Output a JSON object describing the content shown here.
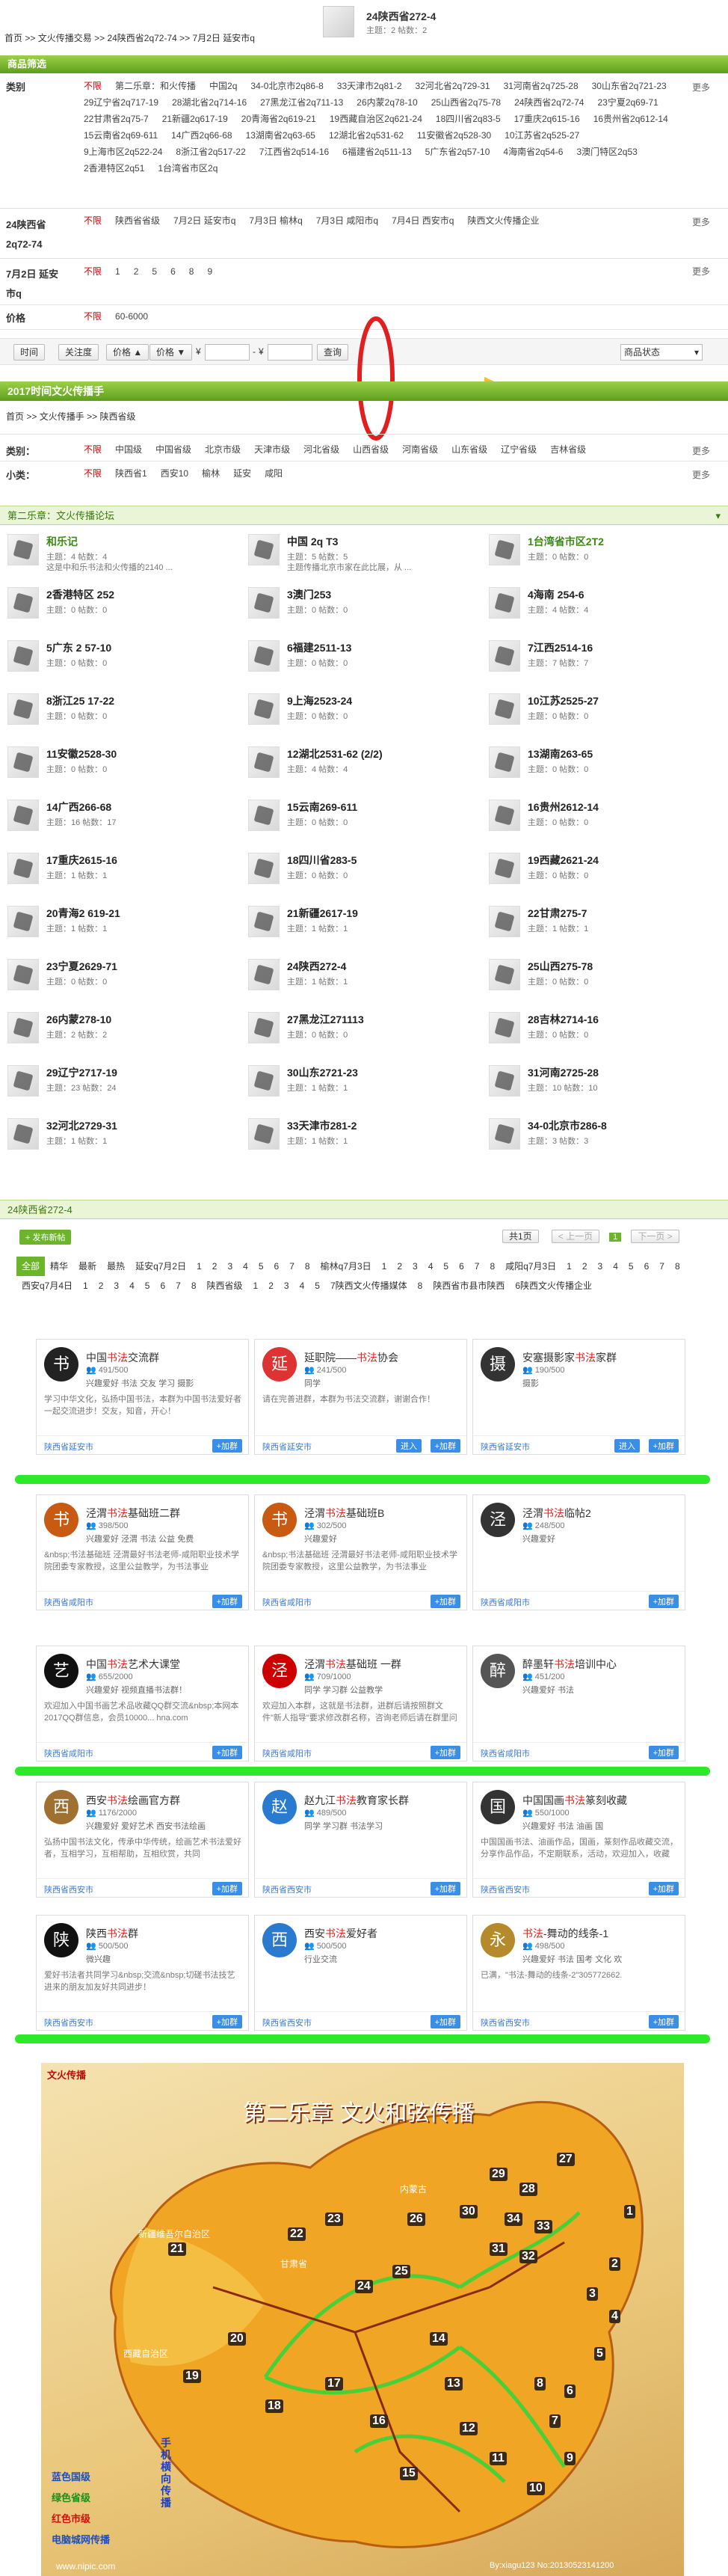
{
  "breadcrumb": {
    "items": [
      "首页",
      ">>",
      "文火传播交易",
      ">>",
      "24陕西省2q72-74",
      ">>",
      "7月2日 延安市q"
    ]
  },
  "forum_header": {
    "title": "24陕西省272-4",
    "stats": "主题：2 帖数：2"
  },
  "filter": {
    "section_title": "商品筛选",
    "rows": [
      {
        "label": "类别",
        "options": [
          "不限",
          "第二乐章：和火传播",
          "中国2q",
          "34-0北京市2q86-8",
          "33天津市2q81-2",
          "32河北省2q729-31",
          "31河南省2q725-28",
          "30山东省2q721-23",
          "29辽宁省2q717-19",
          "28湖北省2q714-16",
          "27黑龙江省2q711-13",
          "26内蒙2q78-10",
          "25山西省2q75-78",
          "24陕西省2q72-74",
          "23宁夏2q69-71",
          "22甘肃省2q75-7",
          "21新疆2q617-19",
          "20青海省2q619-21",
          "19西藏自治区2q621-24",
          "18四川省2q83-5",
          "17重庆2q615-16",
          "16贵州省2q612-14",
          "15云南省2q69-611",
          "14广西2q66-68",
          "13湖南省2q63-65",
          "12湖北省2q531-62",
          "11安徽省2q528-30",
          "10江苏省2q525-27",
          "9上海市区2q522-24",
          "8浙江省2q517-22",
          "7江西省2q514-16",
          "6福建省2q511-13",
          "5广东省2q57-10",
          "4海南省2q54-6",
          "3澳门特区2q53",
          "2香港特区2q51",
          "1台湾省市区2q"
        ],
        "more": "更多"
      },
      {
        "label": "24陕西省2q72-74",
        "options": [
          "不限",
          "陕西省省级",
          "7月2日 延安市q",
          "7月3日 榆林q",
          "7月3日 咸阳市q",
          "7月4日 西安市q",
          "陕西文火传播企业"
        ],
        "more": "更多"
      },
      {
        "label": "7月2日 延安市q",
        "options": [
          "不限",
          "1",
          "2",
          "5",
          "6",
          "8",
          "9"
        ],
        "more": "更多"
      },
      {
        "label": "价格",
        "options": [
          "不限",
          "60-6000"
        ],
        "more": ""
      }
    ]
  },
  "toolbar": {
    "time": "时间",
    "follow": "关注度",
    "price_asc": "价格 ▲",
    "price_desc": "价格 ▼",
    "currency": "¥",
    "dash": "-",
    "query": "查询",
    "status": "商品状态"
  },
  "cat_section": {
    "title": "2017时间文火传播手",
    "crumb": [
      "首页",
      ">>",
      "文火传播手",
      ">>",
      "陕西省级"
    ]
  },
  "cat_filter": {
    "rows": [
      {
        "label": "类别：",
        "options": [
          "不限",
          "中国级",
          "中国省级",
          "北京市级",
          "天津市级",
          "河北省级",
          "山西省级",
          "河南省级",
          "山东省级",
          "辽宁省级",
          "吉林省级"
        ],
        "more": "更多"
      },
      {
        "label": "小类：",
        "options": [
          "不限",
          "陕西省1",
          "西安10",
          "榆林",
          "延安",
          "咸阳"
        ],
        "more": "更多"
      }
    ]
  },
  "forum_section": {
    "title": "第二乐章：文火传播论坛"
  },
  "forums": [
    {
      "name": "和乐记",
      "stat": "主题：4 帖数：4",
      "desc": "这是中和乐书法和火传播的2140 ..."
    },
    {
      "name": "中国 2q T3",
      "stat": "主题：5 帖数：5",
      "desc": "主题传播北京市家在此比展，从 ..."
    },
    {
      "name": "1台湾省市区2T2",
      "stat": "主题：0 帖数：0",
      "desc": ""
    },
    {
      "name": "2香港特区 252",
      "stat": "主题：0 帖数：0",
      "desc": ""
    },
    {
      "name": "3澳门253",
      "stat": "主题：0 帖数：0",
      "desc": ""
    },
    {
      "name": "4海南 254-6",
      "stat": "主题：4 帖数：4",
      "desc": ""
    },
    {
      "name": "5广东 2 57-10",
      "stat": "主题：0 帖数：0",
      "desc": ""
    },
    {
      "name": "6福建2511-13",
      "stat": "主题：0 帖数：0",
      "desc": ""
    },
    {
      "name": "7江西2514-16",
      "stat": "主题：7 帖数：7",
      "desc": ""
    },
    {
      "name": "8浙江25 17-22",
      "stat": "主题：0 帖数：0",
      "desc": ""
    },
    {
      "name": "9上海2523-24",
      "stat": "主题：0 帖数：0",
      "desc": ""
    },
    {
      "name": "10江苏2525-27",
      "stat": "主题：0 帖数：0",
      "desc": ""
    },
    {
      "name": "11安徽2528-30",
      "stat": "主题：0 帖数：0",
      "desc": ""
    },
    {
      "name": "12湖北2531-62 (2/2)",
      "stat": "主题：4 帖数：4",
      "desc": ""
    },
    {
      "name": "13湖南263-65",
      "stat": "主题：0 帖数：0",
      "desc": ""
    },
    {
      "name": "14广西266-68",
      "stat": "主题：16 帖数：17",
      "desc": ""
    },
    {
      "name": "15云南269-611",
      "stat": "主题：0 帖数：0",
      "desc": ""
    },
    {
      "name": "16贵州2612-14",
      "stat": "主题：0 帖数：0",
      "desc": ""
    },
    {
      "name": "17重庆2615-16",
      "stat": "主题：1 帖数：1",
      "desc": ""
    },
    {
      "name": "18四川省283-5",
      "stat": "主题：0 帖数：0",
      "desc": ""
    },
    {
      "name": "19西藏2621-24",
      "stat": "主题：0 帖数：0",
      "desc": ""
    },
    {
      "name": "20青海2 619-21",
      "stat": "主题：1 帖数：1",
      "desc": ""
    },
    {
      "name": "21新疆2617-19",
      "stat": "主题：1 帖数：1",
      "desc": ""
    },
    {
      "name": "22甘肃275-7",
      "stat": "主题：1 帖数：1",
      "desc": ""
    },
    {
      "name": "23宁夏2629-71",
      "stat": "主题：0 帖数：0",
      "desc": ""
    },
    {
      "name": "24陕西272-4",
      "stat": "主题：1 帖数：1",
      "desc": ""
    },
    {
      "name": "25山西275-78",
      "stat": "主题：0 帖数：0",
      "desc": ""
    },
    {
      "name": "26内蒙278-10",
      "stat": "主题：2 帖数：2",
      "desc": ""
    },
    {
      "name": "27黑龙江271113",
      "stat": "主题：0 帖数：0",
      "desc": ""
    },
    {
      "name": "28吉林2714-16",
      "stat": "主题：0 帖数：0",
      "desc": ""
    },
    {
      "name": "29辽宁2717-19",
      "stat": "主题：23 帖数：24",
      "desc": ""
    },
    {
      "name": "30山东2721-23",
      "stat": "主题：1 帖数：1",
      "desc": ""
    },
    {
      "name": "31河南2725-28",
      "stat": "主题：10 帖数：10",
      "desc": ""
    },
    {
      "name": "32河北2729-31",
      "stat": "主题：1 帖数：1",
      "desc": ""
    },
    {
      "name": "33天津市281-2",
      "stat": "主题：1 帖数：1",
      "desc": ""
    },
    {
      "name": "34-0北京市286-8",
      "stat": "主题：3 帖数：3",
      "desc": ""
    }
  ],
  "thread_section": {
    "title": "24陕西省272-4",
    "new_post": "+ 发布新帖",
    "pager_total": "共1页",
    "pager_prev": "< 上一页",
    "pager_current": "1",
    "pager_next": "下一页 >",
    "tabs": [
      "全部",
      "精华",
      "最新",
      "最热",
      "延安q7月2日",
      "1",
      "2",
      "3",
      "4",
      "5",
      "6",
      "7",
      "8",
      "榆林q7月3日",
      "1",
      "2",
      "3",
      "4",
      "5",
      "6",
      "7",
      "8",
      "咸阳q7月3日",
      "1",
      "2",
      "3",
      "4",
      "5",
      "6",
      "7",
      "8",
      "西安q7月4日",
      "1",
      "2",
      "3",
      "4",
      "5",
      "6",
      "7",
      "8",
      "陕西省级",
      "1",
      "2",
      "3",
      "4",
      "5",
      "7陕西文火传播媒体",
      "8",
      "陕西省市县市陕西",
      "6陕西文火传播企业"
    ]
  },
  "groups": [
    {
      "avatar": "书",
      "pre": "中国",
      "hl": "书法",
      "post": "交流群",
      "count": "👥 491/500",
      "tags": "兴趣爱好  书法  交友  学习  摄影",
      "desc": "学习中华文化，弘扬中国书法，本群为中国书法爱好者一起交流进步！交友，知音，开心！",
      "loc": "陕西省延安市",
      "enter": "",
      "join": "+加群"
    },
    {
      "avatar": "延",
      "pre": "延职院——",
      "hl": "书法",
      "post": "协会",
      "count": "👥 241/500",
      "tags": "同学",
      "desc": "请在完善进群，本群为书法交流群，谢谢合作！",
      "loc": "陕西省延安市",
      "enter": "进入",
      "join": "+加群"
    },
    {
      "avatar": "摄",
      "pre": "安塞摄影家",
      "hl": "书法",
      "post": "家群",
      "count": "👥 190/500",
      "tags": "摄影",
      "desc": "",
      "loc": "陕西省延安市",
      "enter": "进入",
      "join": "+加群"
    },
    {
      "avatar": "书",
      "pre": "泾渭",
      "hl": "书法",
      "post": "基础班二群",
      "count": "👥 398/500",
      "tags": "兴趣爱好  泾渭  书法  公益  免费",
      "desc": "&nbsp;书法基础班 泾渭最好书法老师-咸阳职业技术学院团委专家教授，这里公益教学，为书法事业",
      "loc": "陕西省咸阳市",
      "enter": "",
      "join": "+加群"
    },
    {
      "avatar": "书",
      "pre": "泾渭",
      "hl": "书法",
      "post": "基础班B",
      "count": "👥 302/500",
      "tags": "兴趣爱好",
      "desc": "&nbsp;书法基础班 泾渭最好书法老师-咸阳职业技术学院团委专家教授，这里公益教学，为书法事业",
      "loc": "陕西省咸阳市",
      "enter": "",
      "join": "+加群"
    },
    {
      "avatar": "泾",
      "pre": "泾渭",
      "hl": "书法",
      "post": "临帖2",
      "count": "👥 248/500",
      "tags": "兴趣爱好",
      "desc": "",
      "loc": "陕西省咸阳市",
      "enter": "",
      "join": "+加群"
    },
    {
      "avatar": "艺",
      "pre": "中国",
      "hl": "书法",
      "post": "艺术大课堂",
      "count": "👥 655/2000",
      "tags": "兴趣爱好  视频直播书法群！",
      "desc": "欢迎加入中国书画艺术品收藏QQ群交流&nbsp;本网本2017QQ群信息，会员10000... hna.com",
      "loc": "陕西省咸阳市",
      "enter": "",
      "join": "+加群"
    },
    {
      "avatar": "泾",
      "pre": "泾渭",
      "hl": "书法",
      "post": "基础班 一群",
      "count": "👥 709/1000",
      "tags": "同学  学习群  公益教学",
      "desc": "欢迎加入本群，这就是书法群，进群后请按照群文件\"新人指导\"要求修改群名称，咨询老师后请在群里问",
      "loc": "陕西省咸阳市",
      "enter": "",
      "join": "+加群"
    },
    {
      "avatar": "醉",
      "pre": "醉墨轩",
      "hl": "书法",
      "post": "培训中心",
      "count": "👥 451/200",
      "tags": "兴趣爱好  书法",
      "desc": "",
      "loc": "陕西省咸阳市",
      "enter": "",
      "join": "+加群"
    },
    {
      "avatar": "西",
      "pre": "西安",
      "hl": "书法",
      "post": "绘画官方群",
      "count": "👥 1176/2000",
      "tags": "兴趣爱好  爱好艺术  西安书法绘画",
      "desc": "弘扬中国书法文化，传承中华传统，绘画艺术书法爱好者，互相学习，互相帮助，互相欣赏，共同",
      "loc": "陕西省西安市",
      "enter": "",
      "join": "+加群"
    },
    {
      "avatar": "赵",
      "pre": "赵九江",
      "hl": "书法",
      "post": "教育家长群",
      "count": "👥 489/500",
      "tags": "同学  学习群  书法学习",
      "desc": "",
      "loc": "陕西省西安市",
      "enter": "",
      "join": "+加群"
    },
    {
      "avatar": "国",
      "pre": "中国国画",
      "hl": "书法",
      "post": "篆刻收藏",
      "count": "👥 550/1000",
      "tags": "兴趣爱好  书法  油画  国",
      "desc": "中国国画书法、油画作品，国画，篆刻作品收藏交流，分享作品作品，不定期联系，活动，欢迎加入，收藏",
      "loc": "陕西省西安市",
      "enter": "",
      "join": "+加群"
    },
    {
      "avatar": "陕",
      "pre": "陕西",
      "hl": "书法",
      "post": "群",
      "count": "👥 500/500",
      "tags": "微兴趣",
      "desc": "爱好书法者共同学习&nbsp;交流&nbsp;切磋书法技艺进来的朋友加友好共同进步！",
      "loc": "陕西省西安市",
      "enter": "",
      "join": "+加群"
    },
    {
      "avatar": "西",
      "pre": "西安",
      "hl": "书法",
      "post": "爱好者",
      "count": "👥 500/500",
      "tags": "行业交流",
      "desc": "",
      "loc": "陕西省西安市",
      "enter": "",
      "join": "+加群"
    },
    {
      "avatar": "永",
      "pre": "",
      "hl": "书法",
      "post": "-舞动的线条-1",
      "count": "👥 498/500",
      "tags": "兴趣爱好  书法  国考  文化  欢",
      "desc": "已满，\"书法-舞动的线条-2\"305772662.",
      "loc": "陕西省西安市",
      "enter": "",
      "join": "+加群"
    }
  ],
  "map": {
    "title": "第二乐章   文火和弦传播",
    "logo": "文火传播",
    "legend": [
      "蓝色国级",
      "绿色省级",
      "红色市级",
      "电脑城网传播"
    ],
    "side_text": "手机横向传播",
    "watermark_left": "www.nipic.com",
    "watermark_right": "By:xiagu123 No:20130523141200",
    "labels": [
      "1",
      "2",
      "3",
      "4",
      "5",
      "6",
      "7",
      "8",
      "9",
      "10",
      "11",
      "12",
      "13",
      "14",
      "15",
      "16",
      "17",
      "18",
      "19",
      "20",
      "21",
      "22",
      "23",
      "24",
      "25",
      "26",
      "27",
      "28",
      "29",
      "30",
      "31",
      "32",
      "33",
      "34"
    ],
    "region_names": [
      "西藏自治区",
      "新疆维吾尔自治区",
      "内蒙古",
      "甘肃省"
    ]
  }
}
